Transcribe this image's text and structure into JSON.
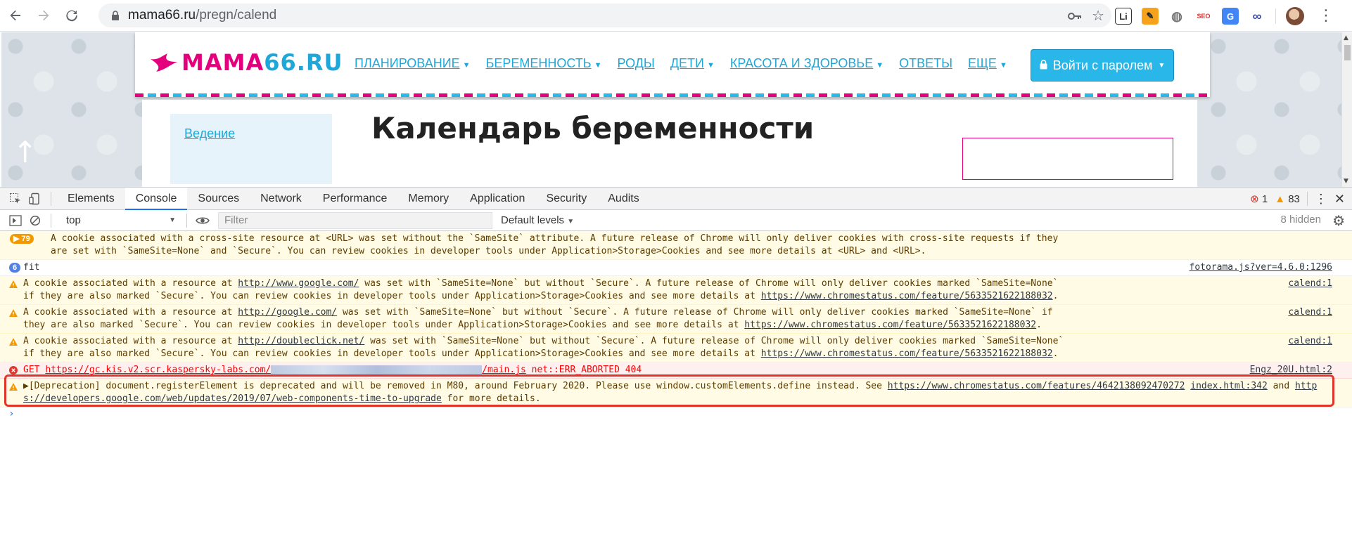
{
  "browser": {
    "url_host": "mama66.ru",
    "url_path": "/pregn/calend",
    "nav": {
      "back": "back-icon",
      "forward": "forward-icon",
      "reload": "reload-icon"
    },
    "extensions": [
      "Li",
      "✎",
      "◍",
      "SEO",
      "G",
      "∞"
    ]
  },
  "site": {
    "logo_main": "MAMA",
    "logo_accent": "66.RU",
    "nav_items": [
      {
        "label": "ПЛАНИРОВАНИЕ",
        "caret": true
      },
      {
        "label": "БЕРЕМЕННОСТЬ",
        "caret": true
      },
      {
        "label": "РОДЫ",
        "caret": false
      },
      {
        "label": "ДЕТИ",
        "caret": true
      },
      {
        "label": "КРАСОТА И ЗДОРОВЬЕ",
        "caret": true
      },
      {
        "label": "ОТВЕТЫ",
        "caret": false
      },
      {
        "label": "ЕЩЕ",
        "caret": true
      }
    ],
    "login_label": "Войти с паролем",
    "sidebar_link": "Ведение",
    "page_title": "Календарь беременности"
  },
  "devtools": {
    "tabs": [
      "Elements",
      "Console",
      "Sources",
      "Network",
      "Performance",
      "Memory",
      "Application",
      "Security",
      "Audits"
    ],
    "active_tab": "Console",
    "error_count": "1",
    "warning_count": "83",
    "context": "top",
    "filter_placeholder": "Filter",
    "levels": "Default levels",
    "hidden": "8 hidden"
  },
  "console": {
    "m0": {
      "badge": "79",
      "text": "A cookie associated with a cross-site resource at <URL> was set without the `SameSite` attribute. A future release of Chrome will only deliver cookies with cross-site requests if they are set with `SameSite=None` and `Secure`. You can review cookies in developer tools under Application>Storage>Cookies and see more details at <URL> and <URL>."
    },
    "m1": {
      "badge": "6",
      "text": "fit",
      "source": "fotorama.js?ver=4.6.0:1296"
    },
    "m2": {
      "pre": "A cookie associated with a resource at ",
      "link": "http://www.google.com/",
      "mid": " was set with `SameSite=None` but without `Secure`. A future release of Chrome will only deliver cookies marked `SameSite=None` if they are also marked `Secure`. You can review cookies in developer tools under Application>Storage>Cookies and see more details at ",
      "link2": "https://www.chromestatus.com/feature/5633521622188032",
      "post": ".",
      "source": "calend:1"
    },
    "m3": {
      "pre": "A cookie associated with a resource at ",
      "link": "http://google.com/",
      "mid": " was set with `SameSite=None` but without `Secure`. A future release of Chrome will only deliver cookies marked `SameSite=None` if they are also marked `Secure`. You can review cookies in developer tools under Application>Storage>Cookies and see more details at ",
      "link2": "https://www.chromestatus.com/feature/5633521622188032",
      "post": ".",
      "source": "calend:1"
    },
    "m4": {
      "pre": "A cookie associated with a resource at ",
      "link": "http://doubleclick.net/",
      "mid": " was set with `SameSite=None` but without `Secure`. A future release of Chrome will only deliver cookies marked `SameSite=None` if they are also marked `Secure`. You can review cookies in developer tools under Application>Storage>Cookies and see more details at ",
      "link2": "https://www.chromestatus.com/feature/5633521622188032",
      "post": ".",
      "source": "calend:1"
    },
    "m5": {
      "method": "GET",
      "link_pre": "https://gc.kis.v2.scr.kaspersky-labs.com/",
      "link_post": "/main.js",
      "error": "net::ERR_ABORTED 404",
      "source": "Engz_20U.html:2"
    },
    "m6": {
      "text": "▶[Deprecation] document.registerElement is deprecated and will be removed in M80, around February 2020. Please use window.customElements.define instead. See ",
      "link": "https://www.chromestatus.com/features/4642138092470272",
      "source": "index.html:342",
      "link2": "https://developers.google.com/web/updates/2019/07/web-components-time-to-upgrade",
      "post": " for more details."
    },
    "prompt": "›"
  },
  "colors": {
    "brand_pink": "#e4007c",
    "brand_blue": "#1ea7d8",
    "highlight": "#e0352b"
  }
}
